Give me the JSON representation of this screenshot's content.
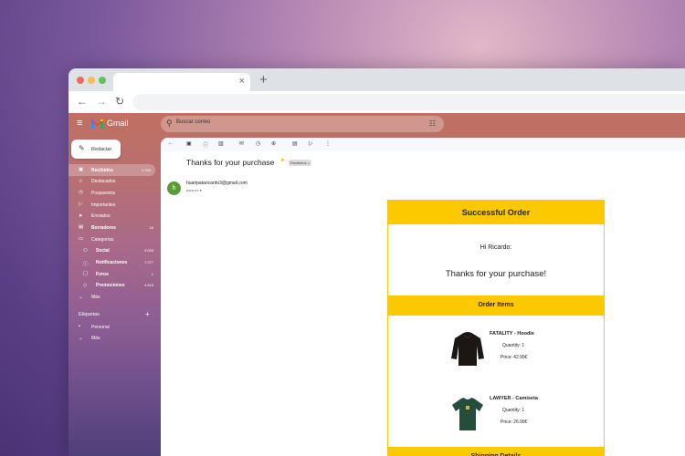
{
  "browser": {
    "tab_close": "×",
    "new_tab": "+",
    "back": "←",
    "forward": "→",
    "reload": "↻"
  },
  "gmail": {
    "menu_icon": "≡",
    "logo_text": "Gmail",
    "search_placeholder": "Buscar correo",
    "tune_icon": "☷",
    "compose_label": "Redactar",
    "compose_icon": "✎",
    "sidebar": [
      {
        "icon": "▣",
        "label": "Recibidos",
        "count": "2.769",
        "active": true,
        "bold": true
      },
      {
        "icon": "☆",
        "label": "Destacados",
        "count": ""
      },
      {
        "icon": "◷",
        "label": "Pospuestos",
        "count": ""
      },
      {
        "icon": "▷",
        "label": "Importantes",
        "count": ""
      },
      {
        "icon": "➤",
        "label": "Enviados",
        "count": ""
      },
      {
        "icon": "▤",
        "label": "Borradores",
        "count": "16",
        "bold": true
      },
      {
        "icon": "▭",
        "label": "Categorías",
        "count": ""
      },
      {
        "icon": "⚇",
        "label": "Social",
        "count": "3.003",
        "sub": true,
        "bold": true
      },
      {
        "icon": "ⓘ",
        "label": "Notificaciones",
        "count": "7.077",
        "sub": true,
        "bold": true
      },
      {
        "icon": "▢",
        "label": "Foros",
        "count": "1",
        "sub": true,
        "bold": true
      },
      {
        "icon": "◇",
        "label": "Promociones",
        "count": "4.616",
        "sub": true,
        "bold": true
      },
      {
        "icon": "⌄",
        "label": "Más",
        "count": ""
      }
    ],
    "labels_title": "Etiquetas",
    "labels_add": "+",
    "labels": [
      {
        "icon": "▪",
        "label": "Personal"
      },
      {
        "icon": "⌄",
        "label": "Más"
      }
    ]
  },
  "message": {
    "subject": "Thanks for your purchase",
    "label_chip": "Recibidos ×",
    "avatar_letter": "h",
    "sender": "huaripataricardo3@gmail.com",
    "recipient": "para mí ▾"
  },
  "email": {
    "header": "Successful Order",
    "greeting": "Hi Ricardo:",
    "thanks": "Thanks for your purchase!",
    "items_title": "Order Items",
    "items": [
      {
        "name": "FATALITY - Hoodie",
        "quantity": "Quantity: 1",
        "price": "Price: 42.99€",
        "color": "#1c1714"
      },
      {
        "name": "LAWYER - Camiseta",
        "quantity": "Quantity: 1",
        "price": "Price: 26.99€",
        "color": "#264d3b"
      }
    ],
    "shipping_title": "Shipping Details"
  }
}
